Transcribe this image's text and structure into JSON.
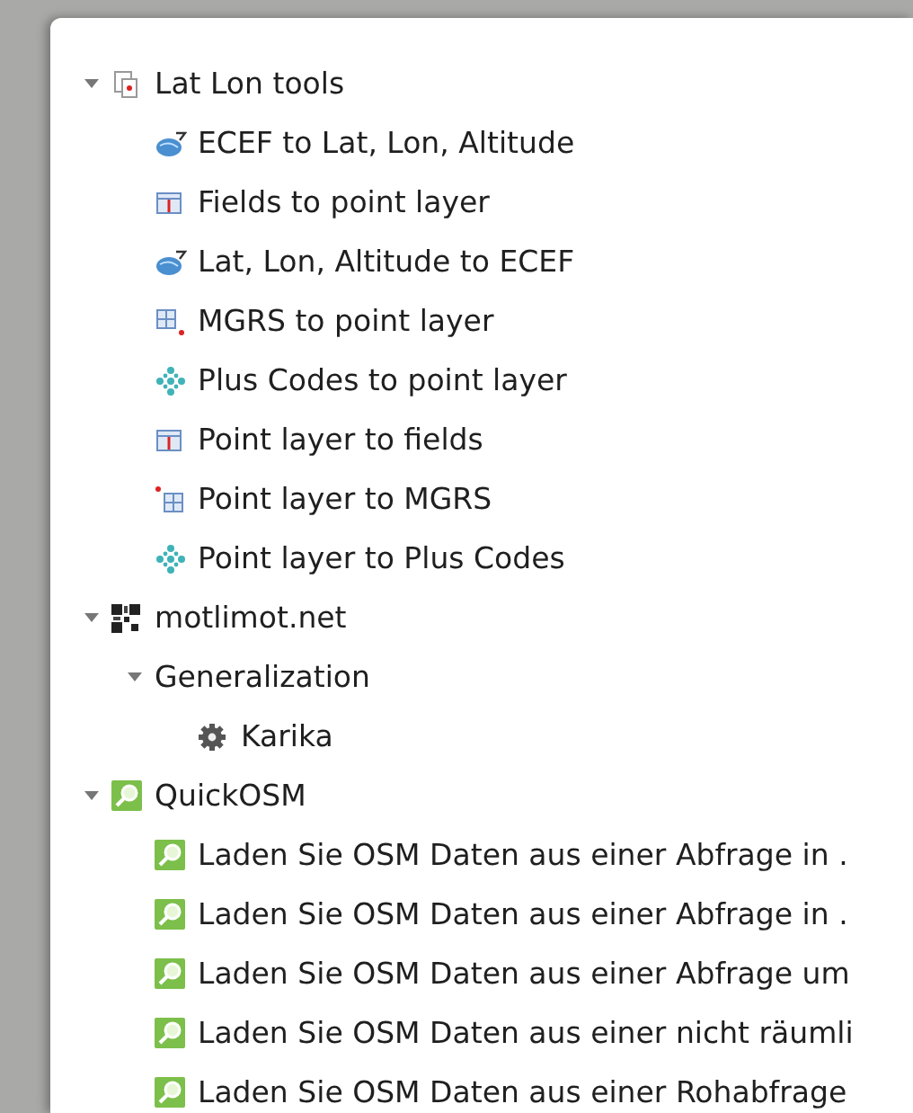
{
  "tree": [
    {
      "label": "Lat Lon tools",
      "kind": "plugin",
      "expanded": true,
      "children": [
        {
          "label": "ECEF to Lat, Lon, Altitude",
          "kind": "globe"
        },
        {
          "label": "Fields to point layer",
          "kind": "table"
        },
        {
          "label": "Lat, Lon, Altitude to ECEF",
          "kind": "globe"
        },
        {
          "label": "MGRS to point layer",
          "kind": "grid-dot"
        },
        {
          "label": "Plus Codes to point layer",
          "kind": "dots"
        },
        {
          "label": "Point layer to fields",
          "kind": "table"
        },
        {
          "label": "Point layer to MGRS",
          "kind": "dot-grid"
        },
        {
          "label": "Point layer to Plus Codes",
          "kind": "dots"
        }
      ]
    },
    {
      "label": "motlimot.net",
      "kind": "qr",
      "expanded": true,
      "children": [
        {
          "label": "Generalization",
          "kind": "none",
          "expanded": true,
          "children": [
            {
              "label": "Karika",
              "kind": "gear"
            }
          ]
        }
      ]
    },
    {
      "label": "QuickOSM",
      "kind": "osm",
      "expanded": true,
      "children": [
        {
          "label": "Laden Sie OSM Daten aus einer Abfrage in .",
          "kind": "osm"
        },
        {
          "label": "Laden Sie OSM Daten aus einer Abfrage in .",
          "kind": "osm"
        },
        {
          "label": "Laden Sie OSM Daten aus einer Abfrage um",
          "kind": "osm"
        },
        {
          "label": "Laden Sie OSM Daten aus einer nicht räumli",
          "kind": "osm"
        },
        {
          "label": "Laden Sie OSM Daten aus einer Rohabfrage",
          "kind": "osm"
        }
      ]
    }
  ]
}
